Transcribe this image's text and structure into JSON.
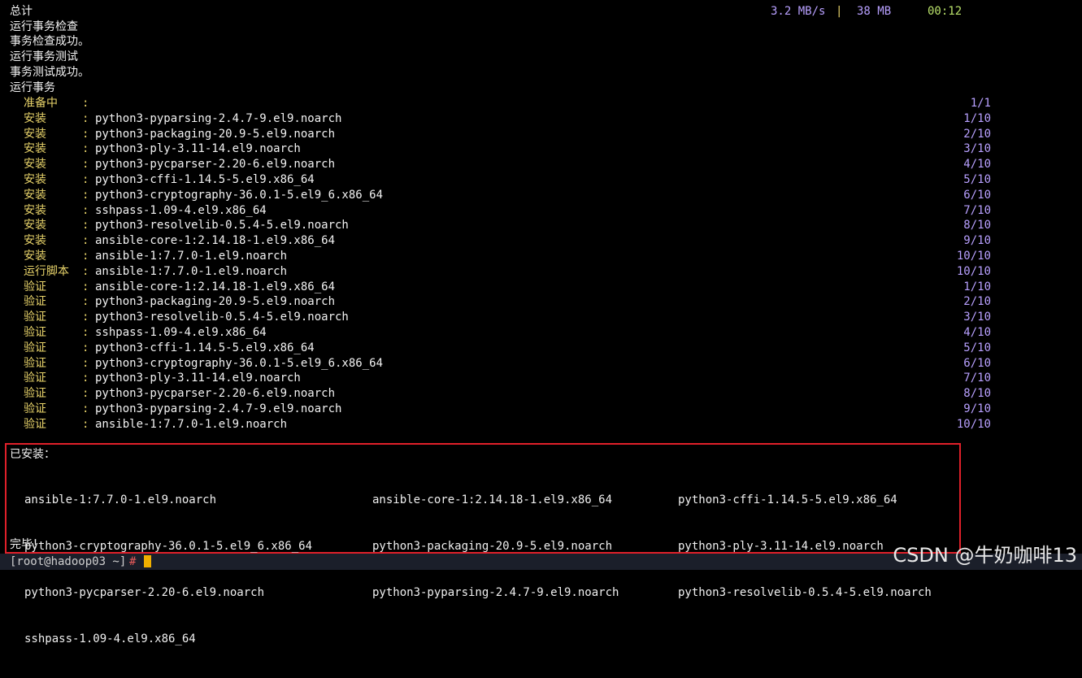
{
  "header": {
    "total_label": "总计",
    "speed": "3.2 MB/s",
    "separator": "|",
    "size": "38 MB",
    "time": "00:12"
  },
  "status_lines": [
    "运行事务检查",
    "事务检查成功。",
    "运行事务测试",
    "事务测试成功。",
    "运行事务"
  ],
  "tasks": [
    {
      "action": "准备中",
      "package": "",
      "progress": "1/1"
    },
    {
      "action": "安装",
      "package": "python3-pyparsing-2.4.7-9.el9.noarch",
      "progress": "1/10"
    },
    {
      "action": "安装",
      "package": "python3-packaging-20.9-5.el9.noarch",
      "progress": "2/10"
    },
    {
      "action": "安装",
      "package": "python3-ply-3.11-14.el9.noarch",
      "progress": "3/10"
    },
    {
      "action": "安装",
      "package": "python3-pycparser-2.20-6.el9.noarch",
      "progress": "4/10"
    },
    {
      "action": "安装",
      "package": "python3-cffi-1.14.5-5.el9.x86_64",
      "progress": "5/10"
    },
    {
      "action": "安装",
      "package": "python3-cryptography-36.0.1-5.el9_6.x86_64",
      "progress": "6/10"
    },
    {
      "action": "安装",
      "package": "sshpass-1.09-4.el9.x86_64",
      "progress": "7/10"
    },
    {
      "action": "安装",
      "package": "python3-resolvelib-0.5.4-5.el9.noarch",
      "progress": "8/10"
    },
    {
      "action": "安装",
      "package": "ansible-core-1:2.14.18-1.el9.x86_64",
      "progress": "9/10"
    },
    {
      "action": "安装",
      "package": "ansible-1:7.7.0-1.el9.noarch",
      "progress": "10/10"
    },
    {
      "action": "运行脚本",
      "package": "ansible-1:7.7.0-1.el9.noarch",
      "progress": "10/10"
    },
    {
      "action": "验证",
      "package": "ansible-core-1:2.14.18-1.el9.x86_64",
      "progress": "1/10"
    },
    {
      "action": "验证",
      "package": "python3-packaging-20.9-5.el9.noarch",
      "progress": "2/10"
    },
    {
      "action": "验证",
      "package": "python3-resolvelib-0.5.4-5.el9.noarch",
      "progress": "3/10"
    },
    {
      "action": "验证",
      "package": "sshpass-1.09-4.el9.x86_64",
      "progress": "4/10"
    },
    {
      "action": "验证",
      "package": "python3-cffi-1.14.5-5.el9.x86_64",
      "progress": "5/10"
    },
    {
      "action": "验证",
      "package": "python3-cryptography-36.0.1-5.el9_6.x86_64",
      "progress": "6/10"
    },
    {
      "action": "验证",
      "package": "python3-ply-3.11-14.el9.noarch",
      "progress": "7/10"
    },
    {
      "action": "验证",
      "package": "python3-pycparser-2.20-6.el9.noarch",
      "progress": "8/10"
    },
    {
      "action": "验证",
      "package": "python3-pyparsing-2.4.7-9.el9.noarch",
      "progress": "9/10"
    },
    {
      "action": "验证",
      "package": "ansible-1:7.7.0-1.el9.noarch",
      "progress": "10/10"
    }
  ],
  "installed": {
    "label": "已安装：",
    "columns": [
      [
        "ansible-1:7.7.0-1.el9.noarch",
        "python3-cryptography-36.0.1-5.el9_6.x86_64",
        "python3-pycparser-2.20-6.el9.noarch",
        "sshpass-1.09-4.el9.x86_64"
      ],
      [
        "ansible-core-1:2.14.18-1.el9.x86_64",
        "python3-packaging-20.9-5.el9.noarch",
        "python3-pyparsing-2.4.7-9.el9.noarch"
      ],
      [
        "python3-cffi-1.14.5-5.el9.x86_64",
        "python3-ply-3.11-14.el9.noarch",
        "python3-resolvelib-0.5.4-5.el9.noarch"
      ]
    ]
  },
  "done_message": "完毕！",
  "prompt": {
    "user_host": "[root@hadoop03 ~]",
    "symbol": "#"
  },
  "watermark": "CSDN @牛奶咖啡13",
  "colors": {
    "background": "#000000",
    "text": "#f0f0f0",
    "yellow": "#e8d36a",
    "purple": "#b8a0ff",
    "green": "#b8e06a",
    "highlight_box": "#e0202a",
    "cursor": "#f0b000"
  }
}
